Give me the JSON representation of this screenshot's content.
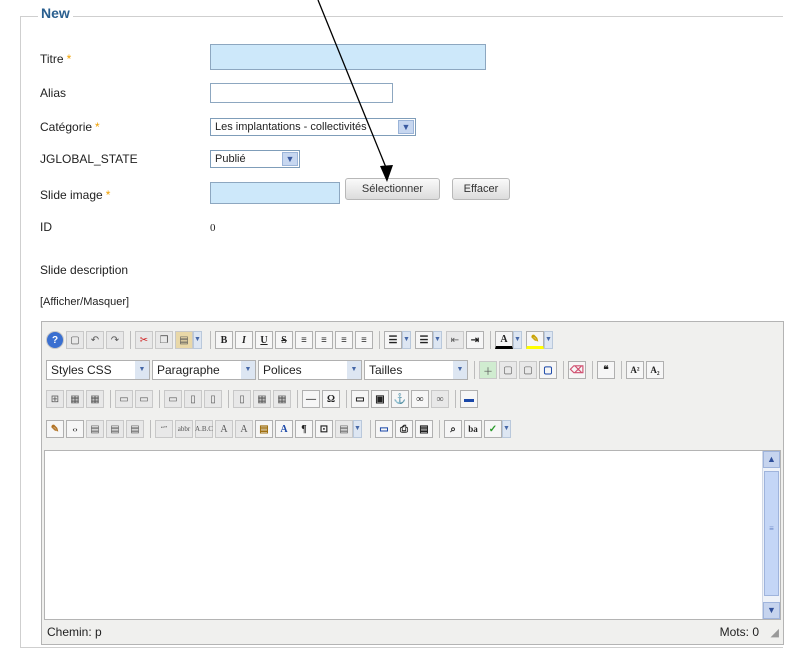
{
  "legend": "New",
  "fields": {
    "titre_label": "Titre",
    "alias_label": "Alias",
    "categorie_label": "Catégorie",
    "categorie_value": "Les implantations - collectivités",
    "state_label": "JGLOBAL_STATE",
    "state_value": "Publié",
    "slide_image_label": "Slide image",
    "select_button": "Sélectionner",
    "clear_button": "Effacer",
    "id_label": "ID",
    "id_value": "0",
    "slide_desc_label": "Slide description",
    "toggle_link": "[Afficher/Masquer]",
    "required_mark": "*"
  },
  "toolbar": {
    "styles": "Styles CSS",
    "format": "Paragraphe",
    "fonts": "Polices",
    "sizes": "Tailles"
  },
  "status": {
    "path": "Chemin: p",
    "words": "Mots: 0"
  },
  "colors": {
    "accent": "#2a5f8f",
    "required": "#f0a000",
    "field_highlight": "#cde8fa"
  }
}
